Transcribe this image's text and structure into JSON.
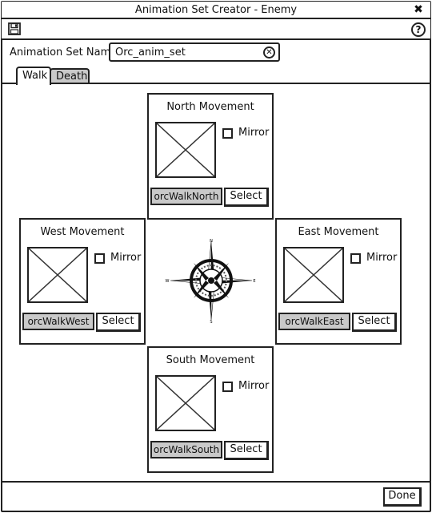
{
  "window": {
    "title": "Animation Set Creator - Enemy",
    "close_icon": "close-x-icon"
  },
  "toolbar": {
    "save_icon": "floppy-disk-icon",
    "help_icon": "help-icon",
    "help_glyph": "?"
  },
  "name_field": {
    "label": "Animation Set Name",
    "value": "Orc_anim_set",
    "clear_icon": "clear-circle-x-icon"
  },
  "tabs": [
    {
      "label": "Walk",
      "active": true
    },
    {
      "label": "Death",
      "active": false
    }
  ],
  "directions": {
    "north": {
      "title": "North Movement",
      "mirror_label": "Mirror",
      "mirror_checked": false,
      "animation": "orcWalkNorth",
      "select_label": "Select"
    },
    "west": {
      "title": "West Movement",
      "mirror_label": "Mirror",
      "mirror_checked": false,
      "animation": "orcWalkWest",
      "select_label": "Select"
    },
    "east": {
      "title": "East Movement",
      "mirror_label": "Mirror",
      "mirror_checked": false,
      "animation": "orcWalkEast",
      "select_label": "Select"
    },
    "south": {
      "title": "South Movement",
      "mirror_label": "Mirror",
      "mirror_checked": false,
      "animation": "orcWalkSouth",
      "select_label": "Select"
    }
  },
  "compass": {
    "icon": "compass-rose-icon",
    "n": "N",
    "e": "E",
    "s": "S",
    "w": "W"
  },
  "footer": {
    "done_label": "Done"
  }
}
